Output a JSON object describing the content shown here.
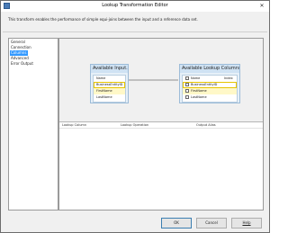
{
  "window": {
    "title": "Lookup Transformation Editor",
    "close_glyph": "✕"
  },
  "description": "This transform enables the performance of simple equi-joins between the input and a reference data set.",
  "nav": {
    "items": [
      "General",
      "Connection",
      "Columns",
      "Advanced",
      "Error Output"
    ],
    "selected": "Columns"
  },
  "input_box": {
    "title": "Available Input...",
    "columns": [
      "Name",
      "BusinessEntityID",
      "FirstName",
      "LastName"
    ]
  },
  "lookup_box": {
    "title": "Available Lookup Columns",
    "header": {
      "name": "Name",
      "index": "Index"
    },
    "columns": [
      "BusinessEntityID",
      "FirstName",
      "LastName"
    ]
  },
  "grid": {
    "headers": [
      "Lookup Column",
      "Lookup Operation",
      "Output Alias"
    ]
  },
  "buttons": {
    "ok": "OK",
    "cancel": "Cancel",
    "help": "Help"
  },
  "colors": {
    "selection": "#3399ff",
    "box_header": "#cfe2f3",
    "highlight": "#fff8c8"
  }
}
